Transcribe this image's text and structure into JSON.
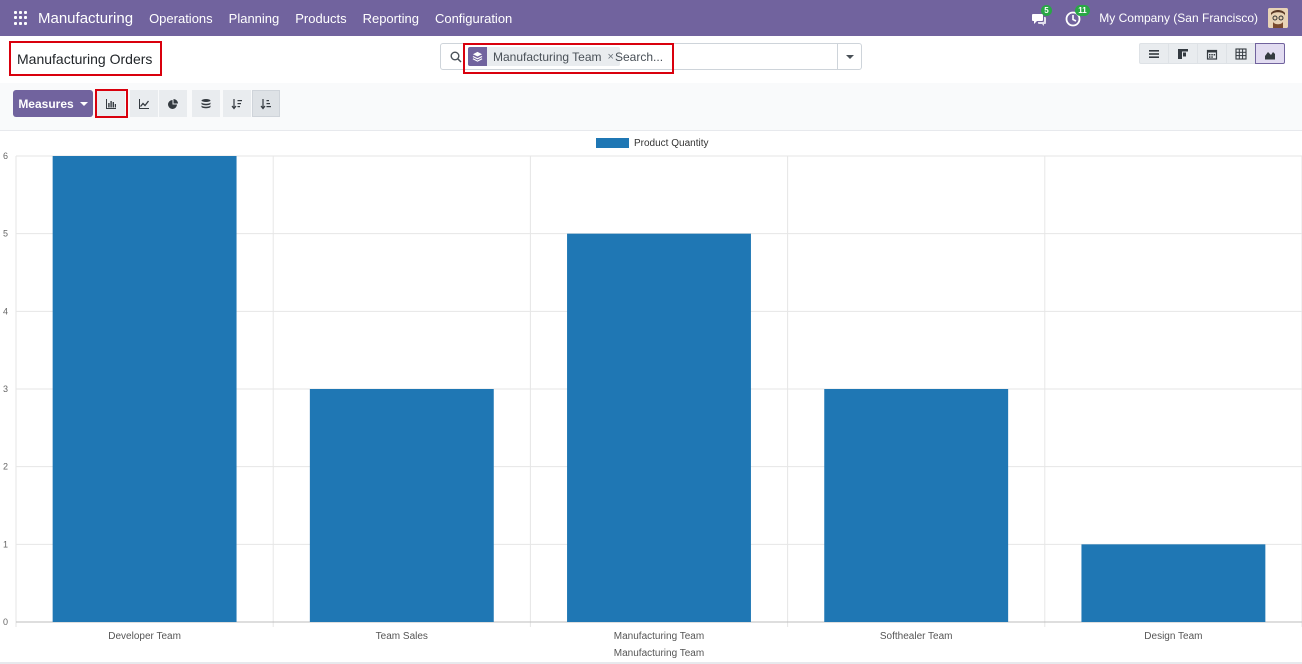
{
  "nav": {
    "app_name": "Manufacturing",
    "menu": [
      "Operations",
      "Planning",
      "Products",
      "Reporting",
      "Configuration"
    ],
    "messages_count": "5",
    "activities_count": "11",
    "company": "My Company (San Francisco)"
  },
  "control_panel": {
    "title": "Manufacturing Orders",
    "search": {
      "facet_label": "Manufacturing Team",
      "facet_remove": "×",
      "placeholder": "Search..."
    },
    "views": [
      "list-icon",
      "kanban-icon",
      "calendar-icon",
      "pivot-icon",
      "graph-icon"
    ],
    "active_view": "graph"
  },
  "toolbar": {
    "measures_label": "Measures",
    "buttons": [
      "bar-chart-icon",
      "line-chart-icon",
      "pie-chart-icon",
      "stacked-icon",
      "descending-icon",
      "ascending-icon"
    ],
    "active_chart": "bar"
  },
  "colors": {
    "brand": "#71639e",
    "bar": "#1f77b4",
    "highlight": "#d9000d",
    "badge": "#28a745"
  },
  "chart_data": {
    "type": "bar",
    "categories": [
      "Developer  Team",
      "Team Sales",
      "Manufacturing  Team",
      "Softhealer Team",
      "Design Team"
    ],
    "series": [
      {
        "name": "Product Quantity",
        "values": [
          6,
          3,
          5,
          3,
          1
        ]
      }
    ],
    "xlabel": "Manufacturing Team",
    "ylabel": "",
    "ylim": [
      0,
      6
    ],
    "yticks": [
      0,
      1,
      2,
      3,
      4,
      5,
      6
    ],
    "grid": true,
    "legend": "top-center"
  }
}
